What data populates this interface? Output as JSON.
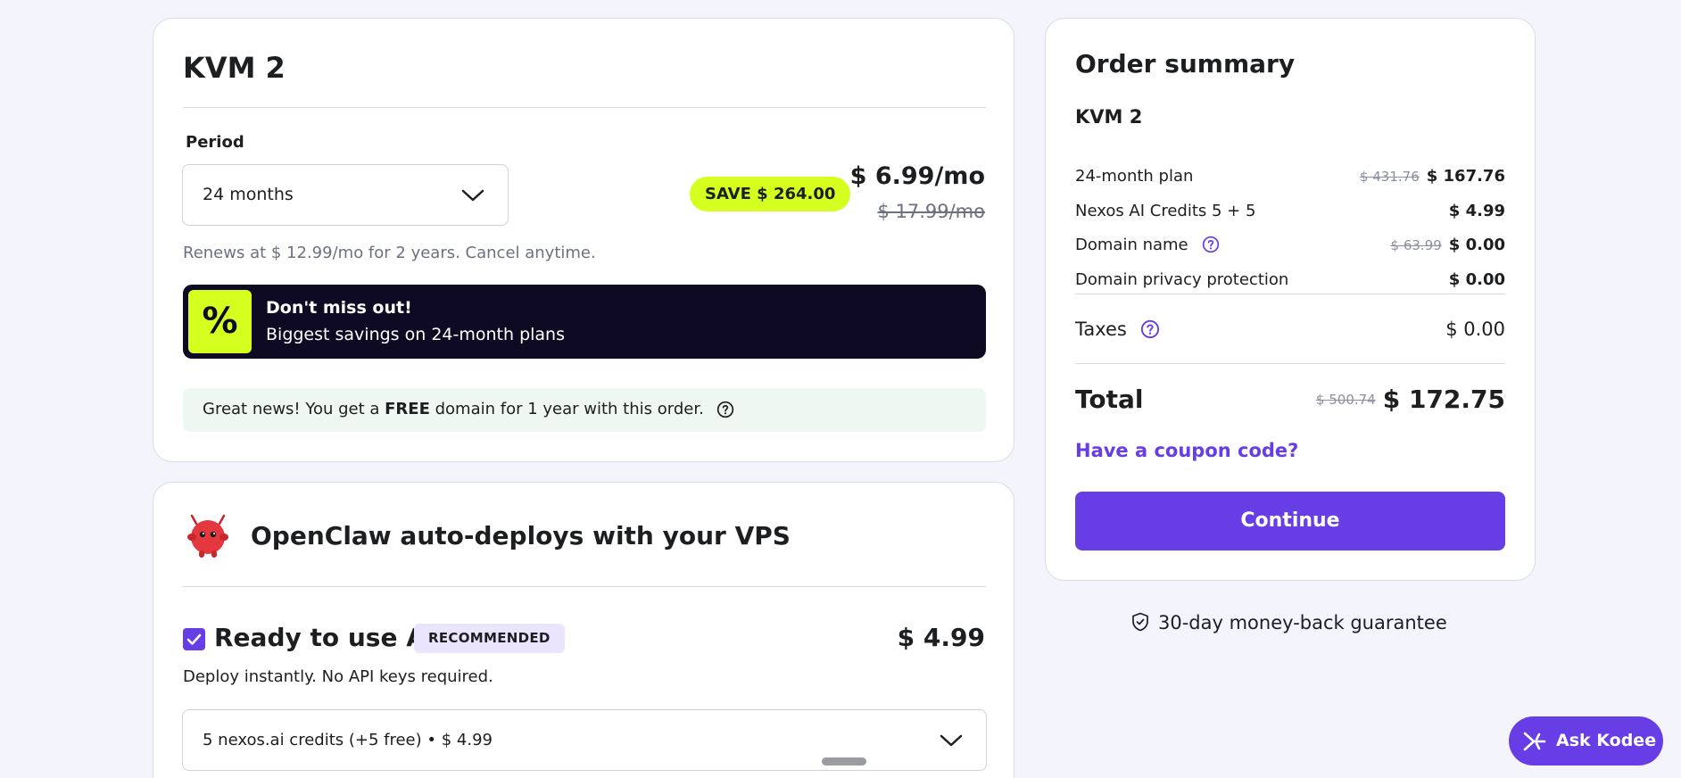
{
  "plan": {
    "title": "KVM 2",
    "period_label": "Period",
    "period_value": "24 months",
    "save_badge": "SAVE $ 264.00",
    "price": "$ 6.99/mo",
    "old_price": "$ 17.99/mo",
    "renews": "Renews at $ 12.99/mo for 2 years. Cancel anytime.",
    "promo": {
      "icon": "%",
      "title": "Don't miss out!",
      "subtitle": "Biggest savings on 24-month plans"
    },
    "free_domain": {
      "before": "Great news! You get a ",
      "bold": "FREE",
      "after": " domain for 1 year with this order."
    }
  },
  "addon": {
    "title": "OpenClaw auto-deploys with your VPS",
    "option_title": "Ready to use AI",
    "badge": "RECOMMENDED",
    "price": "$ 4.99",
    "description": "Deploy instantly. No API keys required.",
    "credits_value": "5 nexos.ai credits (+5 free) • $ 4.99",
    "checked": true
  },
  "summary": {
    "title": "Order summary",
    "product": "KVM 2",
    "rows": [
      {
        "label": "24-month plan",
        "old": "$ 431.76",
        "value": "$ 167.76"
      },
      {
        "label": "Nexos AI Credits 5 + 5",
        "old": "",
        "value": "$ 4.99"
      },
      {
        "label": "Domain name",
        "old": "$ 63.99",
        "value": "$ 0.00"
      },
      {
        "label": "Domain privacy protection",
        "old": "",
        "value": "$ 0.00"
      }
    ],
    "taxes_label": "Taxes",
    "taxes_value": "$ 0.00",
    "total_label": "Total",
    "total_old": "$ 500.74",
    "total_value": "$ 172.75",
    "coupon": "Have a coupon code?",
    "continue": "Continue",
    "guarantee": "30-day money-back guarantee"
  },
  "assistant": {
    "label": "Ask Kodee"
  },
  "colors": {
    "accent": "#673de6",
    "lime": "#d4ff1f",
    "dark": "#0e0a24",
    "page_bg": "#f4f4fc"
  }
}
